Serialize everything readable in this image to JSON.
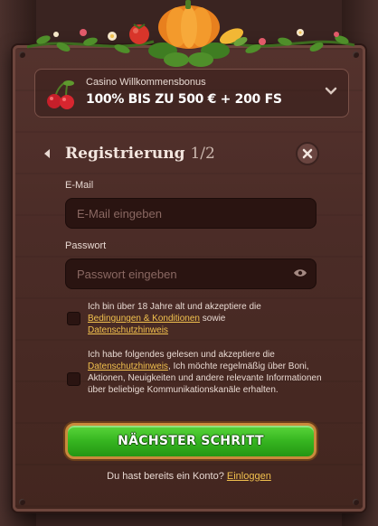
{
  "bonus": {
    "title": "Casino Willkommensbonus",
    "value": "100% BIS ZU 500 € + 200 FS"
  },
  "registration": {
    "title": "Registrierung",
    "step": "1/2"
  },
  "email": {
    "label": "E-Mail",
    "placeholder": "E-Mail eingeben"
  },
  "password": {
    "label": "Passwort",
    "placeholder": "Passwort eingeben"
  },
  "consent_age": {
    "text_before": "Ich bin über 18 Jahre alt und akzeptiere die",
    "link_terms": "Bedingungen & Konditionen",
    "text_mid": "sowie",
    "link_privacy": "Datenschutzhinweis"
  },
  "consent_marketing": {
    "text_before": "Ich habe folgendes gelesen und akzeptiere die",
    "link_privacy": "Datenschutzhinweis",
    "text_after": ", Ich möchte regelmäßig über Boni, Aktionen, Neuigkeiten und andere relevante Informationen über beliebige Kommunikationskanäle erhalten."
  },
  "next_button": {
    "label": "NÄCHSTER SCHRITT"
  },
  "login": {
    "prompt": "Du hast bereits ein Konto?",
    "link": "Einloggen"
  },
  "colors": {
    "panel": "#4b2c27",
    "accent_link": "#f2c14e",
    "button_green": "#36b520",
    "input_bg": "#2a1411"
  },
  "icons": [
    "cherry-icon",
    "chevron-down-icon",
    "back-arrow-icon",
    "close-icon",
    "eye-icon",
    "pumpkin-icon"
  ]
}
